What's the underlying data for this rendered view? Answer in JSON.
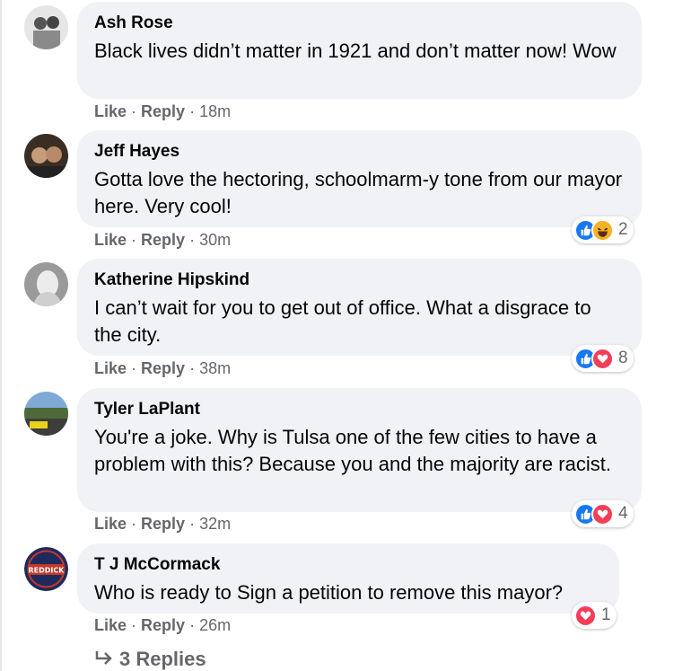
{
  "comments": [
    {
      "author": "Ash Rose",
      "text": "Black lives didn’t matter in 1921 and don’t matter now! Wow",
      "like": "Like",
      "reply": "Reply",
      "time": "18m",
      "reaction_count": ""
    },
    {
      "author": "Jeff Hayes",
      "text": "Gotta love the hectoring, schoolmarm-y tone from our mayor here. Very cool!",
      "like": "Like",
      "reply": "Reply",
      "time": "30m",
      "reaction_count": "2",
      "reactions": [
        "like-icon",
        "haha-icon"
      ]
    },
    {
      "author": "Katherine Hipskind",
      "text": "I can’t wait for you to get out of office. What a disgrace to the city.",
      "like": "Like",
      "reply": "Reply",
      "time": "38m",
      "reaction_count": "8",
      "reactions": [
        "like-icon",
        "love-icon"
      ]
    },
    {
      "author": "Tyler LaPlant",
      "text": "You're a joke. Why is Tulsa one of the few cities to have a problem with this? Because you and the majority are racist.",
      "like": "Like",
      "reply": "Reply",
      "time": "32m",
      "reaction_count": "4",
      "reactions": [
        "like-icon",
        "love-icon"
      ]
    },
    {
      "author": "T J McCormack",
      "text": "Who is ready to Sign a petition to remove this mayor?",
      "like": "Like",
      "reply": "Reply",
      "time": "26m",
      "reaction_count": "1",
      "reactions": [
        "love-icon"
      ],
      "avatar_badge": "REDDICK"
    }
  ],
  "replies_link": {
    "label": "3 Replies"
  },
  "colors": {
    "bubble": "#f0f2f5",
    "meta": "#65676b",
    "like": "#1877f2",
    "love": "#f33e58",
    "haha": "#f7b125"
  }
}
